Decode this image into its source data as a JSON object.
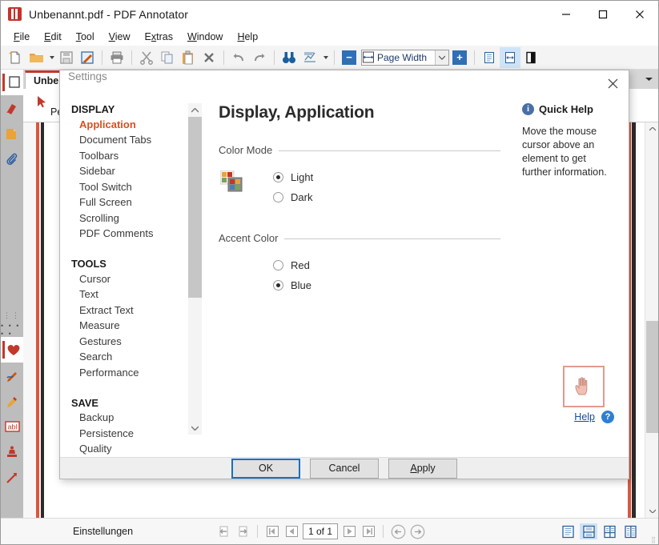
{
  "window": {
    "title": "Unbenannt.pdf - PDF Annotator",
    "app_icon": "pdf-annotator-logo",
    "minimize": "−",
    "maximize": "□",
    "close": "✕"
  },
  "menubar": {
    "items": [
      {
        "label": "File",
        "accel": "F"
      },
      {
        "label": "Edit",
        "accel": "E"
      },
      {
        "label": "Tool",
        "accel": "T"
      },
      {
        "label": "View",
        "accel": "V"
      },
      {
        "label": "Extras",
        "accel": "x"
      },
      {
        "label": "Window",
        "accel": "W"
      },
      {
        "label": "Help",
        "accel": "H"
      }
    ]
  },
  "toolbar": {
    "buttons": [
      {
        "name": "new-document-icon",
        "title": "New"
      },
      {
        "name": "open-folder-icon",
        "title": "Open"
      },
      {
        "name": "open-dropdown-caret-icon",
        "title": "Open recent"
      },
      {
        "name": "save-icon",
        "title": "Save"
      },
      {
        "name": "save-annotations-icon",
        "title": "Save annotated"
      },
      {
        "name": "print-icon",
        "title": "Print"
      },
      {
        "name": "cut-scissors-icon",
        "title": "Cut"
      },
      {
        "name": "copy-icon",
        "title": "Copy"
      },
      {
        "name": "paste-icon",
        "title": "Paste"
      },
      {
        "name": "delete-x-icon",
        "title": "Delete"
      },
      {
        "name": "undo-icon",
        "title": "Undo"
      },
      {
        "name": "redo-icon",
        "title": "Redo"
      },
      {
        "name": "find-binoculars-icon",
        "title": "Find"
      },
      {
        "name": "chart-icon",
        "title": "Extras"
      },
      {
        "name": "chart-dropdown-caret-icon",
        "title": "Extras menu"
      }
    ],
    "zoom": {
      "minus_label": "−",
      "plus_label": "+",
      "value": "Page Width",
      "dropdown_icon": "chevron-down-icon"
    },
    "view_buttons": [
      {
        "name": "fit-page-icon"
      },
      {
        "name": "fit-width-icon",
        "selected": true
      },
      {
        "name": "page-contrast-icon"
      }
    ]
  },
  "rail": {
    "top_items": [
      {
        "name": "pages-thumbnail-icon",
        "selected": true
      },
      {
        "name": "bookmark-icon",
        "selected": false
      },
      {
        "name": "folder-icon",
        "selected": false
      },
      {
        "name": "attachments-paperclip-icon",
        "selected": false
      }
    ],
    "bottom_items": [
      {
        "name": "favorites-heart-icon",
        "selected": true
      },
      {
        "name": "pen-blue-icon",
        "selected": false
      },
      {
        "name": "highlighter-icon",
        "selected": false
      },
      {
        "name": "text-box-abl-icon",
        "selected": false
      },
      {
        "name": "stamp-icon",
        "selected": false
      },
      {
        "name": "arrow-tool-icon",
        "selected": false
      }
    ]
  },
  "doctab": {
    "label": "Unbenannt.pdf",
    "overflow_icon": "chevron-down-icon"
  },
  "toolstrip": {
    "pen_label": "Pen",
    "items": [
      {
        "name": "cursor-arrow-icon"
      },
      {
        "name": "text-cursor-icon"
      }
    ],
    "squiggle_icon": "red-squiggle-ink-icon"
  },
  "statusbar": {
    "status_text": "Einstellungen",
    "nav": {
      "prev_view_icon": "go-back-view-icon",
      "next_view_icon": "go-forward-view-icon",
      "first_page_icon": "first-page-icon",
      "prev_page_icon": "previous-page-icon",
      "page_value": "1 of 1",
      "next_page_icon": "next-page-icon",
      "last_page_icon": "last-page-icon",
      "back_icon": "navigate-back-icon",
      "forward_icon": "navigate-forward-icon"
    },
    "view_modes": [
      {
        "name": "single-page-view-icon",
        "selected": false
      },
      {
        "name": "continuous-view-icon",
        "selected": true
      },
      {
        "name": "two-page-view-icon",
        "selected": false
      },
      {
        "name": "two-page-continuous-view-icon",
        "selected": false
      }
    ]
  },
  "dialog": {
    "title": "Settings",
    "close_icon": "close-icon",
    "nav": {
      "sections": [
        {
          "header": "DISPLAY",
          "items": [
            {
              "label": "Application",
              "active": true
            },
            {
              "label": "Document Tabs",
              "active": false
            },
            {
              "label": "Toolbars",
              "active": false
            },
            {
              "label": "Sidebar",
              "active": false
            },
            {
              "label": "Tool Switch",
              "active": false
            },
            {
              "label": "Full Screen",
              "active": false
            },
            {
              "label": "Scrolling",
              "active": false
            },
            {
              "label": "PDF Comments",
              "active": false
            }
          ]
        },
        {
          "header": "TOOLS",
          "items": [
            {
              "label": "Cursor",
              "active": false
            },
            {
              "label": "Text",
              "active": false
            },
            {
              "label": "Extract Text",
              "active": false
            },
            {
              "label": "Measure",
              "active": false
            },
            {
              "label": "Gestures",
              "active": false
            },
            {
              "label": "Search",
              "active": false
            },
            {
              "label": "Performance",
              "active": false
            }
          ]
        },
        {
          "header": "SAVE",
          "items": [
            {
              "label": "Backup",
              "active": false
            },
            {
              "label": "Persistence",
              "active": false
            },
            {
              "label": "Quality",
              "active": false
            }
          ]
        }
      ],
      "scroll_up_icon": "chevron-up-icon",
      "scroll_down_icon": "chevron-down-icon"
    },
    "panel": {
      "heading": "Display, Application",
      "groups": [
        {
          "label": "Color Mode",
          "icon": "color-swatch-icon",
          "options": [
            {
              "label": "Light",
              "selected": true
            },
            {
              "label": "Dark",
              "selected": false
            }
          ]
        },
        {
          "label": "Accent Color",
          "icon": null,
          "options": [
            {
              "label": "Red",
              "selected": false
            },
            {
              "label": "Blue",
              "selected": true
            }
          ]
        }
      ]
    },
    "quickhelp": {
      "icon": "info-icon",
      "title": "Quick Help",
      "text": "Move the mouse cursor above an element to get further information."
    },
    "help": {
      "hand_icon": "hand-cursor-icon",
      "link_label": "Help",
      "link_accel": "H",
      "question_icon": "question-mark-icon"
    },
    "footer": {
      "ok_label": "OK",
      "cancel_label": "Cancel",
      "apply_label": "Apply",
      "apply_accel": "A"
    }
  },
  "colors": {
    "accent_red": "#c0392b",
    "accent_blue": "#2f6fb5",
    "active_nav": "#d94f20",
    "focus_blue": "#1a6fc4"
  }
}
